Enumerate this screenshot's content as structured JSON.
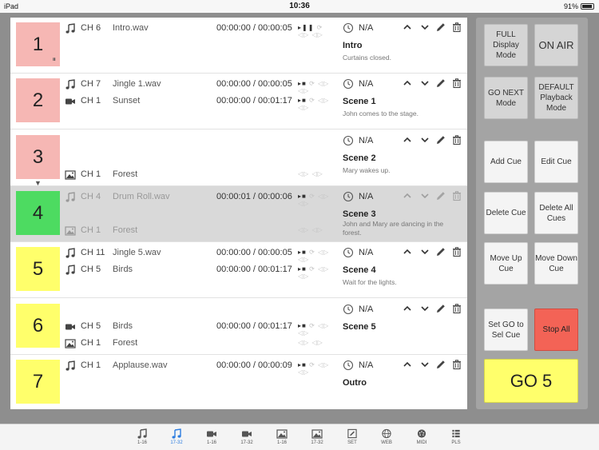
{
  "status_bar": {
    "device": "iPad",
    "time": "10:36",
    "battery": "91%"
  },
  "cues": [
    {
      "number": "1",
      "color": "#f6b7b4",
      "sub_icon": "pause-circle",
      "lines": [
        {
          "icon": "music-note",
          "channel": "CH 6",
          "name": "Intro.wav",
          "time": "00:00:00 / 00:00:05",
          "controls": "pause",
          "enabled": true
        }
      ],
      "timer": "N/A",
      "title": "Intro",
      "description": "Curtains closed."
    },
    {
      "number": "2",
      "color": "#f6b7b4",
      "lines": [
        {
          "icon": "music-note",
          "channel": "CH 7",
          "name": "Jingle 1.wav",
          "time": "00:00:00 / 00:00:05",
          "controls": "play",
          "enabled": true
        },
        {
          "icon": "video-camera",
          "channel": "CH 1",
          "name": "Sunset",
          "time": "00:00:00 / 00:01:17",
          "controls": "play",
          "enabled": true
        }
      ],
      "timer": "N/A",
      "title": "Scene 1",
      "description": "John comes to the stage."
    },
    {
      "number": "3",
      "color": "#f6b7b4",
      "has_arrow": true,
      "lines": [
        {
          "icon": "image",
          "channel": "CH 1",
          "name": "Forest",
          "time": "",
          "controls": "fade",
          "enabled": true
        }
      ],
      "timer": "N/A",
      "title": "Scene 2",
      "description": "Mary wakes up."
    },
    {
      "number": "4",
      "color": "#4ddb61",
      "selected": true,
      "lines": [
        {
          "icon": "music-note",
          "channel": "CH 4",
          "name": "Drum Roll.wav",
          "time": "00:00:01 / 00:00:06",
          "controls": "play",
          "enabled": true
        },
        {
          "icon": "image",
          "channel": "CH 1",
          "name": "Forest",
          "time": "",
          "controls": "fade",
          "enabled": true
        }
      ],
      "timer": "N/A",
      "title": "Scene 3",
      "description": "John and Mary are dancing in the forest."
    },
    {
      "number": "5",
      "color": "#ffff6b",
      "lines": [
        {
          "icon": "music-note",
          "channel": "CH 11",
          "name": "Jingle 5.wav",
          "time": "00:00:00 / 00:00:05",
          "controls": "play",
          "enabled": true
        },
        {
          "icon": "music-note",
          "channel": "CH 5",
          "name": "Birds",
          "time": "00:00:00 / 00:01:17",
          "controls": "play",
          "enabled": true
        }
      ],
      "timer": "N/A",
      "title": "Scene 4",
      "description": "Wait for the lights."
    },
    {
      "number": "6",
      "color": "#ffff6b",
      "lines": [
        {
          "icon": "video-camera",
          "channel": "CH 5",
          "name": "Birds",
          "time": "00:00:00 / 00:01:17",
          "controls": "play",
          "enabled": true
        },
        {
          "icon": "image",
          "channel": "CH 1",
          "name": "Forest",
          "time": "",
          "controls": "fade",
          "enabled": true
        }
      ],
      "timer": "N/A",
      "title": "Scene 5",
      "description": ""
    },
    {
      "number": "7",
      "color": "#ffff6b",
      "lines": [
        {
          "icon": "music-note",
          "channel": "CH 1",
          "name": "Applause.wav",
          "time": "00:00:00 / 00:00:09",
          "controls": "play",
          "enabled": true
        }
      ],
      "timer": "N/A",
      "title": "Outro",
      "description": ""
    }
  ],
  "panel": {
    "full_display": "FULL Display Mode",
    "on_air": "ON AIR",
    "go_next": "GO NEXT Mode",
    "default_playback": "DEFAULT Playback Mode",
    "add_cue": "Add Cue",
    "edit_cue": "Edit Cue",
    "delete_cue": "Delete Cue",
    "delete_all": "Delete All Cues",
    "move_up": "Move Up Cue",
    "move_down": "Move Down Cue",
    "set_go": "Set GO to Sel Cue",
    "stop_all": "Stop All",
    "go": "GO 5"
  },
  "tabs": [
    {
      "icon": "music-note",
      "label": "1-16",
      "active": false
    },
    {
      "icon": "music-note",
      "label": "17-32",
      "active": true
    },
    {
      "icon": "video-camera",
      "label": "1-16",
      "active": false
    },
    {
      "icon": "video-camera",
      "label": "17-32",
      "active": false
    },
    {
      "icon": "image",
      "label": "1-16",
      "active": false
    },
    {
      "icon": "image",
      "label": "17-32",
      "active": false
    },
    {
      "icon": "settings-pencil",
      "label": "SET",
      "active": false
    },
    {
      "icon": "globe",
      "label": "WEB",
      "active": false
    },
    {
      "icon": "midi-connector",
      "label": "MIDI",
      "active": false
    },
    {
      "icon": "playlist",
      "label": "PLS",
      "active": false
    }
  ]
}
